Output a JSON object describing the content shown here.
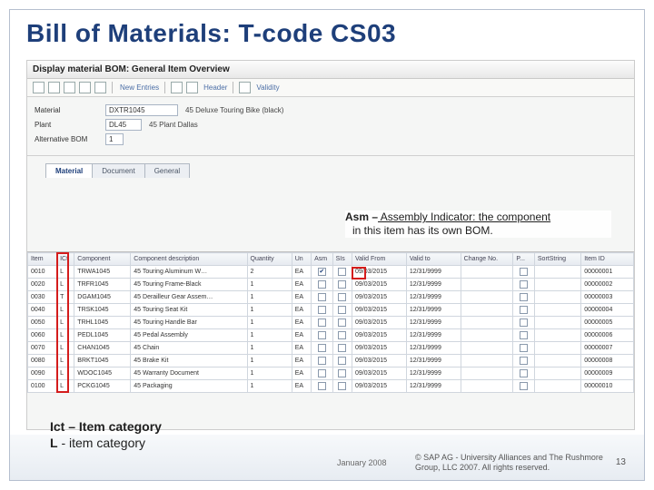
{
  "slide_title": "Bill of Materials: T-code CS03",
  "window_title": "Display material BOM: General Item Overview",
  "toolbar": {
    "new_entries": "New Entries",
    "header": "Header",
    "validity": "Validity"
  },
  "form": {
    "material_label": "Material",
    "material_value": "DXTR1045",
    "material_desc": "45 Deluxe Touring Bike (black)",
    "plant_label": "Plant",
    "plant_value": "DL45",
    "plant_desc": "45 Plant Dallas",
    "altbom_label": "Alternative BOM",
    "altbom_value": "1"
  },
  "tabs": {
    "material": "Material",
    "document": "Document",
    "general": "General"
  },
  "annotations": {
    "asm_bold": "Asm –",
    "asm_text": " Assembly Indicator: the component",
    "asm_line2": "in this item has its own BOM.",
    "ict_l1_b": "Ict – Item category",
    "ict_l2_b": "L",
    "ict_l2": " - item category"
  },
  "grid": {
    "headers": [
      "Item",
      "ICt",
      "Component",
      "Component description",
      "Quantity",
      "Un",
      "Asm",
      "SIs",
      "Valid From",
      "Valid to",
      "Change No.",
      "P...",
      "SortString",
      "Item ID"
    ],
    "rows": [
      {
        "item": "0010",
        "ict": "L",
        "comp": "TRWA1045",
        "desc": "45 Touring Aluminum W…",
        "qty": "2",
        "un": "EA",
        "asm": true,
        "sis": false,
        "from": "09/03/2015",
        "to": "12/31/9999",
        "id": "00000001"
      },
      {
        "item": "0020",
        "ict": "L",
        "comp": "TRFR1045",
        "desc": "45 Touring Frame-Black",
        "qty": "1",
        "un": "EA",
        "asm": false,
        "sis": false,
        "from": "09/03/2015",
        "to": "12/31/9999",
        "id": "00000002"
      },
      {
        "item": "0030",
        "ict": "T",
        "comp": "DGAM1045",
        "desc": "45 Derailleur Gear Assem…",
        "qty": "1",
        "un": "EA",
        "asm": false,
        "sis": false,
        "from": "09/03/2015",
        "to": "12/31/9999",
        "id": "00000003"
      },
      {
        "item": "0040",
        "ict": "L",
        "comp": "TRSK1045",
        "desc": "45 Touring Seat Kit",
        "qty": "1",
        "un": "EA",
        "asm": false,
        "sis": false,
        "from": "09/03/2015",
        "to": "12/31/9999",
        "id": "00000004"
      },
      {
        "item": "0050",
        "ict": "L",
        "comp": "TRHL1045",
        "desc": "45 Touring Handle Bar",
        "qty": "1",
        "un": "EA",
        "asm": false,
        "sis": false,
        "from": "09/03/2015",
        "to": "12/31/9999",
        "id": "00000005"
      },
      {
        "item": "0060",
        "ict": "L",
        "comp": "PEDL1045",
        "desc": "45 Pedal Assembly",
        "qty": "1",
        "un": "EA",
        "asm": false,
        "sis": false,
        "from": "09/03/2015",
        "to": "12/31/9999",
        "id": "00000006"
      },
      {
        "item": "0070",
        "ict": "L",
        "comp": "CHAN1045",
        "desc": "45 Chain",
        "qty": "1",
        "un": "EA",
        "asm": false,
        "sis": false,
        "from": "09/03/2015",
        "to": "12/31/9999",
        "id": "00000007"
      },
      {
        "item": "0080",
        "ict": "L",
        "comp": "BRKT1045",
        "desc": "45 Brake Kit",
        "qty": "1",
        "un": "EA",
        "asm": false,
        "sis": false,
        "from": "09/03/2015",
        "to": "12/31/9999",
        "id": "00000008"
      },
      {
        "item": "0090",
        "ict": "L",
        "comp": "WDOC1045",
        "desc": "45 Warranty Document",
        "qty": "1",
        "un": "EA",
        "asm": false,
        "sis": false,
        "from": "09/03/2015",
        "to": "12/31/9999",
        "id": "00000009"
      },
      {
        "item": "0100",
        "ict": "L",
        "comp": "PCKG1045",
        "desc": "45 Packaging",
        "qty": "1",
        "un": "EA",
        "asm": false,
        "sis": false,
        "from": "09/03/2015",
        "to": "12/31/9999",
        "id": "00000010"
      }
    ]
  },
  "footer": {
    "date": "January 2008",
    "copy": "© SAP AG - University Alliances and The Rushmore Group, LLC 2007. All rights reserved.",
    "page": "13"
  }
}
